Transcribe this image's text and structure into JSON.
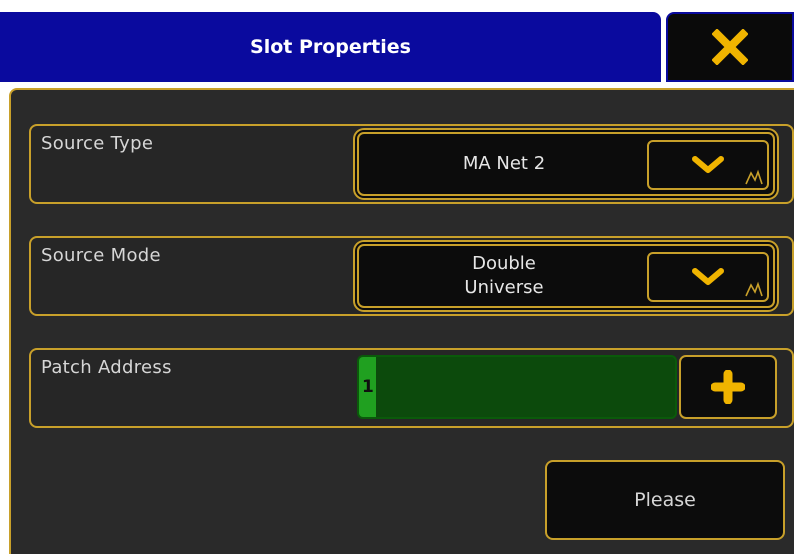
{
  "dialog": {
    "title": "Slot Properties",
    "close_icon": "close-icon"
  },
  "rows": {
    "source_type": {
      "label": "Source Type",
      "value": "MA Net 2",
      "icon": "chevron-down-icon"
    },
    "source_mode": {
      "label": "Source Mode",
      "value_line1": "Double",
      "value_line2": "Universe",
      "icon": "chevron-down-icon"
    },
    "patch_address": {
      "label": "Patch Address",
      "value": "1",
      "icon": "plus-icon"
    }
  },
  "actions": {
    "please_label": "Please"
  },
  "colors": {
    "title_bar": "#0a0a9e",
    "accent": "#c8a02a",
    "icon": "#f0b400",
    "field_bg": "#0c0c0c",
    "panel_bg": "#2a2a2a",
    "patch_bg": "#0c4a0c",
    "patch_cursor": "#20a020"
  }
}
